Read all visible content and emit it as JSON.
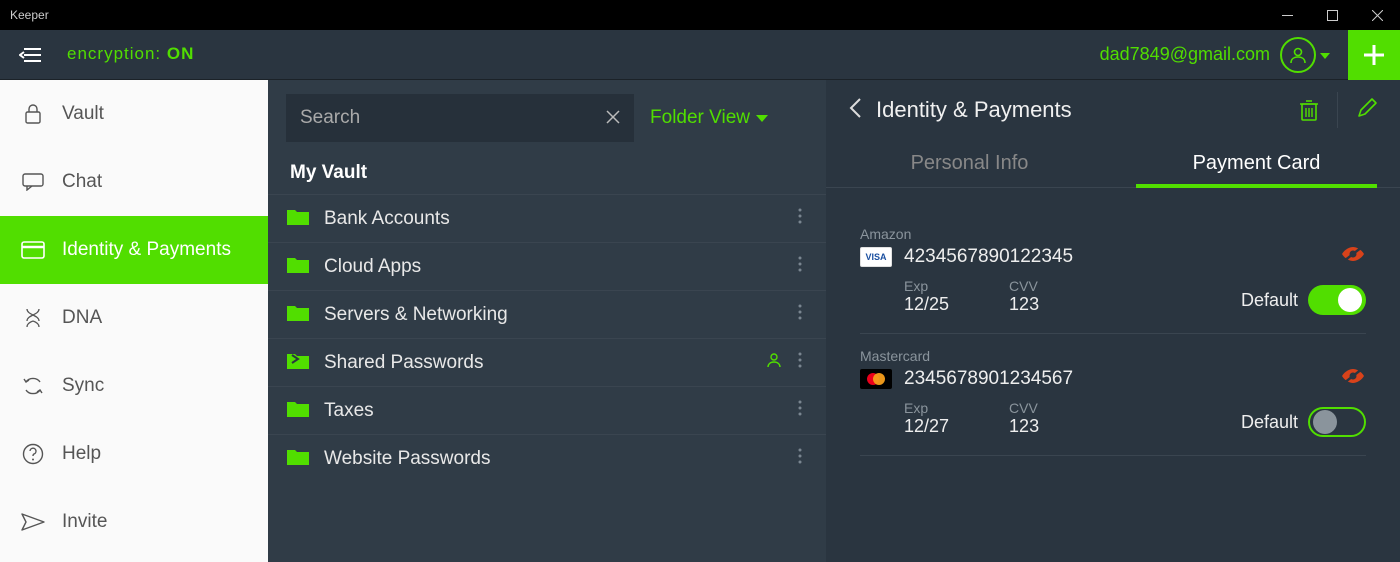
{
  "window": {
    "title": "Keeper"
  },
  "header": {
    "encryption_label": "encryption: ",
    "encryption_state": "ON",
    "user_email": "dad7849@gmail.com"
  },
  "nav": {
    "items": [
      {
        "label": "Vault",
        "icon": "lock-icon",
        "active": false
      },
      {
        "label": "Chat",
        "icon": "chat-icon",
        "active": false
      },
      {
        "label": "Identity & Payments",
        "icon": "card-icon",
        "active": true
      },
      {
        "label": "DNA",
        "icon": "dna-icon",
        "active": false
      },
      {
        "label": "Sync",
        "icon": "sync-icon",
        "active": false
      },
      {
        "label": "Help",
        "icon": "help-icon",
        "active": false
      },
      {
        "label": "Invite",
        "icon": "invite-icon",
        "active": false
      }
    ]
  },
  "folders": {
    "search_placeholder": "Search",
    "view_label": "Folder View",
    "section_label": "My Vault",
    "items": [
      {
        "name": "Bank Accounts",
        "shared": false
      },
      {
        "name": "Cloud Apps",
        "shared": false
      },
      {
        "name": "Servers & Networking",
        "shared": false
      },
      {
        "name": "Shared Passwords",
        "shared": true
      },
      {
        "name": "Taxes",
        "shared": false
      },
      {
        "name": "Website Passwords",
        "shared": false
      }
    ]
  },
  "detail": {
    "title": "Identity & Payments",
    "tabs": [
      {
        "label": "Personal Info",
        "active": false
      },
      {
        "label": "Payment Card",
        "active": true
      }
    ],
    "default_label": "Default",
    "exp_label": "Exp",
    "cvv_label": "CVV",
    "cards": [
      {
        "name": "Amazon",
        "brand": "visa",
        "number": "4234567890122345",
        "exp": "12/25",
        "cvv": "123",
        "default": true
      },
      {
        "name": "Mastercard",
        "brand": "mc",
        "number": "2345678901234567",
        "exp": "12/27",
        "cvv": "123",
        "default": false
      }
    ]
  }
}
